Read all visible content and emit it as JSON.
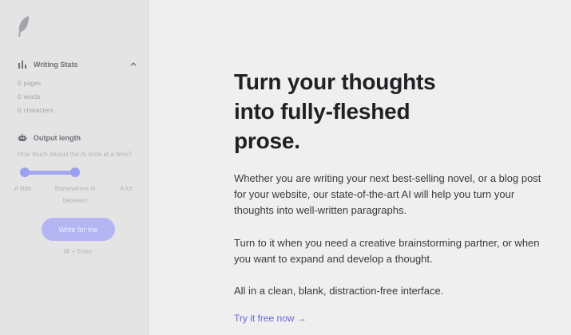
{
  "sidebar": {
    "logo_icon": "feather-icon",
    "writing_stats": {
      "title": "Writing Stats",
      "icon": "bar-chart-icon",
      "stats": [
        {
          "value": "0",
          "label": "pages"
        },
        {
          "value": "0",
          "label": "words"
        },
        {
          "value": "0",
          "label": "characters"
        }
      ]
    },
    "output_length": {
      "title": "Output length",
      "icon": "robot-icon",
      "hint": "How much should the AI write at a time?",
      "options": [
        "A little",
        "Somewhere in between",
        "A lot"
      ],
      "option_lines": [
        "Somewhere in",
        "between"
      ]
    },
    "write_button": "Write for me",
    "shortcut": "⌘ + Enter"
  },
  "main": {
    "headline": "Turn your thoughts into fully-fleshed prose.",
    "headline_lines": [
      "Turn your thoughts",
      "into fully-fleshed",
      "prose."
    ],
    "paragraphs": [
      "Whether you are writing your next best-selling novel, or a blog post for your website, our state-of-the-art AI will help you turn your thoughts into well-written paragraphs.",
      "Turn to it when you need a creative brainstorming partner, or when you want to expand and develop a thought.",
      "All in a clean, blank, distraction-free interface."
    ],
    "cta": "Try it free now →"
  },
  "colors": {
    "accent": "#6366d9",
    "button": "#b4b6f4",
    "sidebar_bg": "#e4e4e5",
    "main_bg": "#efefef"
  }
}
